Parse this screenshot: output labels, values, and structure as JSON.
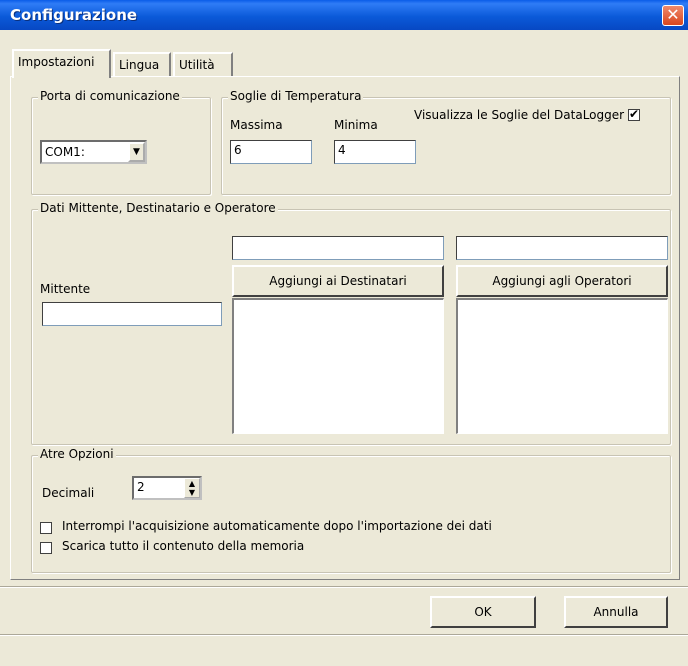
{
  "window": {
    "title": "Configurazione",
    "close_glyph": "✕"
  },
  "tabs": [
    {
      "label": "Impostazioni",
      "active": true
    },
    {
      "label": "Lingua",
      "active": false
    },
    {
      "label": "Utilità",
      "active": false
    }
  ],
  "porta": {
    "group_label": "Porta di comunicazione",
    "value": "COM1:",
    "arrow_icon": "▼"
  },
  "soglie": {
    "group_label": "Soglie di Temperatura",
    "massima_label": "Massima",
    "massima_value": "6",
    "minima_label": "Minima",
    "minima_value": "4",
    "visualizza_label": "Visualizza le Soglie del DataLogger",
    "visualizza_checked": true,
    "check_glyph": "✔"
  },
  "dati": {
    "group_label": "Dati Mittente, Destinatario e Operatore",
    "mittente_label": "Mittente",
    "mittente_value": "",
    "destinatario_value": "",
    "operatore_value": "",
    "add_destinatari_label": "Aggiungi ai Destinatari",
    "add_operatori_label": "Aggiungi agli Operatori"
  },
  "opzioni": {
    "group_label": "Atre Opzioni",
    "decimali_label": "Decimali",
    "decimali_value": "2",
    "spin_up": "▲",
    "spin_down": "▼",
    "interrompi_label": "Interrompi l'acquisizione automaticamente dopo l'importazione dei dati",
    "interrompi_checked": false,
    "scarica_label": "Scarica tutto il contenuto della memoria",
    "scarica_checked": false
  },
  "footer": {
    "ok_label": "OK",
    "cancel_label": "Annulla"
  }
}
